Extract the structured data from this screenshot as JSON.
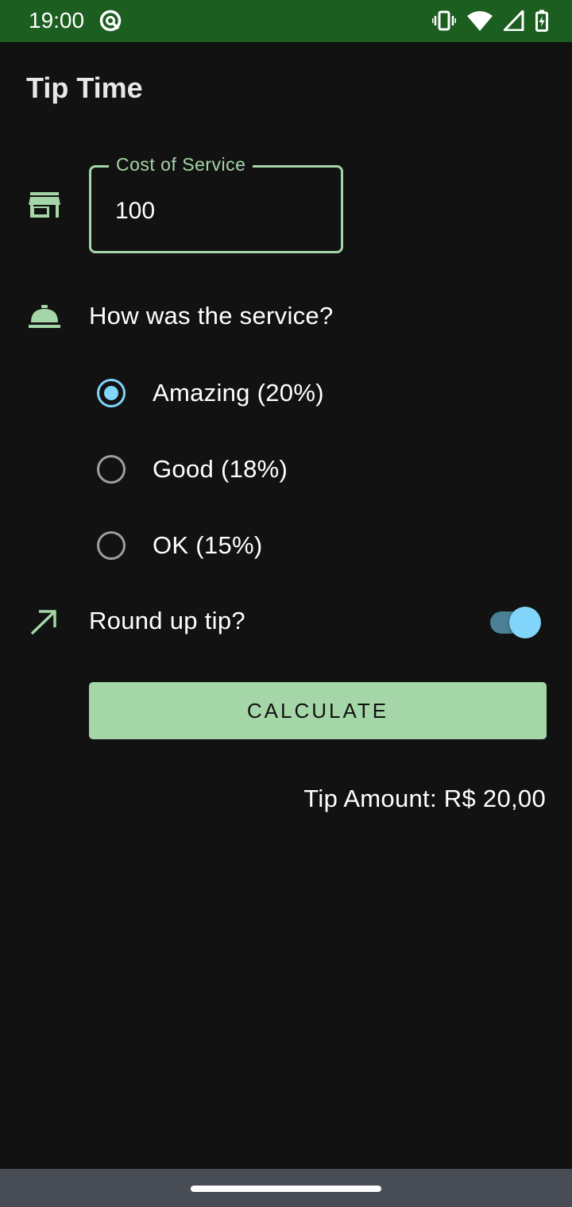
{
  "status_bar": {
    "time": "19:00",
    "icons": [
      "app-notification-icon",
      "vibrate-icon",
      "wifi-icon",
      "cell-signal-icon",
      "battery-charging-icon"
    ]
  },
  "app": {
    "title": "Tip Time"
  },
  "cost_field": {
    "label": "Cost of Service",
    "value": "100"
  },
  "service": {
    "question": "How was the service?",
    "options": [
      {
        "label": "Amazing (20%)",
        "selected": true
      },
      {
        "label": "Good (18%)",
        "selected": false
      },
      {
        "label": "OK (15%)",
        "selected": false
      }
    ]
  },
  "round_up": {
    "label": "Round up tip?",
    "enabled": true
  },
  "calculate": {
    "label": "CALCULATE"
  },
  "result": {
    "text": "Tip Amount: R$ 20,00"
  },
  "colors": {
    "status_bar": "#1b5e20",
    "background": "#121212",
    "accent_green": "#a5d6a7",
    "accent_blue": "#81d4fa",
    "nav_bar": "#474c55"
  }
}
